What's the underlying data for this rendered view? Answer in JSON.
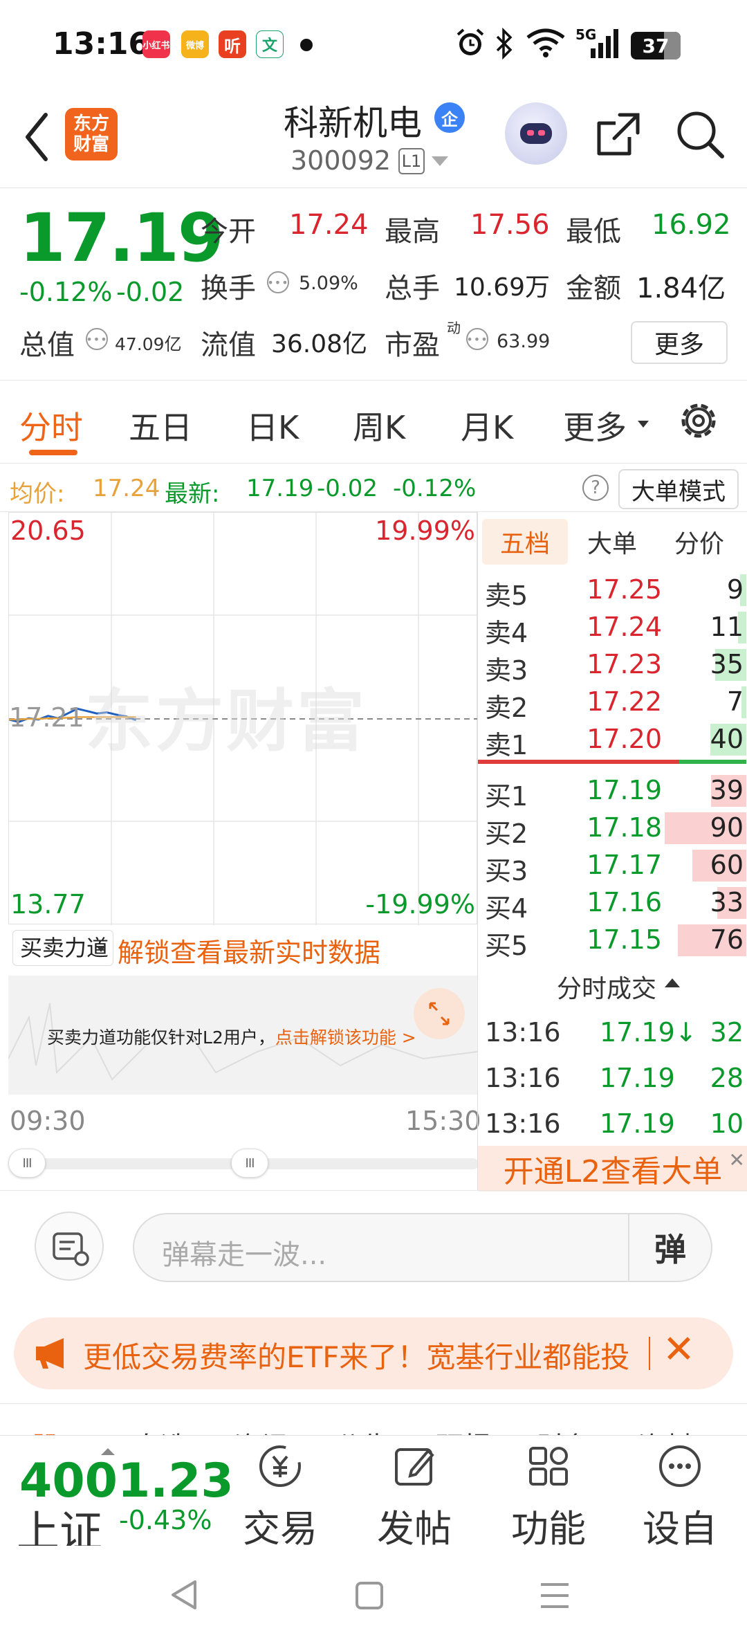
{
  "status_bar": {
    "time": "13:16",
    "battery": "37",
    "apps": [
      "小红书",
      "微博",
      "听",
      "文"
    ],
    "network": "5G"
  },
  "header": {
    "logo_text": "东方财富",
    "stock_name": "科新机电",
    "badge": "企",
    "stock_code": "300092",
    "level": "L1"
  },
  "quote": {
    "price": "17.19",
    "change_pct": "-0.12%",
    "change": "-0.02",
    "open_label": "今开",
    "open": "17.24",
    "high_label": "最高",
    "high": "17.56",
    "low_label": "最低",
    "low": "16.92",
    "turnover_label": "换手",
    "turnover": "5.09%",
    "volume_label": "总手",
    "volume": "10.69万",
    "amount_label": "金额",
    "amount": "1.84亿",
    "total_cap_label": "总值",
    "total_cap": "47.09亿",
    "float_cap_label": "流值",
    "float_cap": "36.08亿",
    "pe_label": "市盈",
    "pe_sup": "动",
    "pe": "63.99",
    "more": "更多"
  },
  "tabs": {
    "items": [
      "分时",
      "五日",
      "日K",
      "周K",
      "月K",
      "更多"
    ],
    "active": "分时"
  },
  "avg_row": {
    "avg_label": "均价:",
    "avg_value": "17.24",
    "latest_label": "最新:",
    "latest_value": "17.19",
    "latest_change": "-0.02",
    "latest_pct": "-0.12%",
    "help": "?",
    "big_order_mode": "大单模式"
  },
  "chart": {
    "y_max": "20.65",
    "y_min": "13.77",
    "pct_max": "19.99%",
    "pct_min": "-19.99%",
    "prev_close": "17.21",
    "watermark": "东方财富",
    "time_start": "09:30",
    "time_end": "15:30",
    "colors": {
      "price_line": "#1f5fbf",
      "avg_line": "#e8a23a"
    }
  },
  "chart_data": {
    "type": "line",
    "ylim": [
      13.77,
      20.65
    ],
    "series": [
      {
        "values": [
          17.2,
          17.16,
          17.22,
          17.2,
          17.26,
          17.22,
          17.3,
          17.38,
          17.34,
          17.3,
          17.32,
          17.28,
          17.25,
          17.19
        ]
      },
      {
        "values": [
          17.2,
          17.2,
          17.21,
          17.21,
          17.22,
          17.22,
          17.23,
          17.24,
          17.24,
          17.24,
          17.24,
          17.24,
          17.24,
          17.24
        ]
      }
    ]
  },
  "indicator": {
    "select": "买卖力道",
    "unlock_title": "解锁查看最新实时数据",
    "message": "买卖力道功能仅针对L2用户，",
    "link": "点击解锁该功能 >"
  },
  "book": {
    "tabs": [
      "五档",
      "大单",
      "分价"
    ],
    "active_tab": "五档",
    "asks": [
      {
        "label": "卖5",
        "price": "17.25",
        "vol": "9",
        "bar": 0.08
      },
      {
        "label": "卖4",
        "price": "17.24",
        "vol": "11",
        "bar": 0.1
      },
      {
        "label": "卖3",
        "price": "17.23",
        "vol": "35",
        "bar": 0.38
      },
      {
        "label": "卖2",
        "price": "17.22",
        "vol": "7",
        "bar": 0.06
      },
      {
        "label": "卖1",
        "price": "17.20",
        "vol": "40",
        "bar": 0.44
      }
    ],
    "bids": [
      {
        "label": "买1",
        "price": "17.19",
        "vol": "39",
        "bar": 0.43
      },
      {
        "label": "买2",
        "price": "17.18",
        "vol": "90",
        "bar": 1.0
      },
      {
        "label": "买3",
        "price": "17.17",
        "vol": "60",
        "bar": 0.66
      },
      {
        "label": "买4",
        "price": "17.16",
        "vol": "33",
        "bar": 0.36
      },
      {
        "label": "买5",
        "price": "17.15",
        "vol": "76",
        "bar": 0.84
      }
    ],
    "ratio_red": 0.75,
    "trades_title": "分时成交",
    "trades": [
      {
        "time": "13:16",
        "price": "17.19↓",
        "vol": "32"
      },
      {
        "time": "13:16",
        "price": "17.19",
        "vol": "28"
      },
      {
        "time": "13:16",
        "price": "17.19",
        "vol": "10"
      }
    ],
    "l2_banner": "开通L2查看大单"
  },
  "danmu": {
    "placeholder": "弹幕走一波...",
    "send": "弹"
  },
  "ad": {
    "text": "更低交易费率的ETF来了！宽基行业都能投"
  },
  "peek_tabs": [
    "股吧",
    "自选",
    "资讯",
    "公告",
    "研报",
    "财务",
    "资料"
  ],
  "toolbar": {
    "index_value": "4001.23",
    "index_name": "上证",
    "index_change": "-0.43%",
    "items": [
      "交易",
      "发帖",
      "功能",
      "设自"
    ]
  }
}
